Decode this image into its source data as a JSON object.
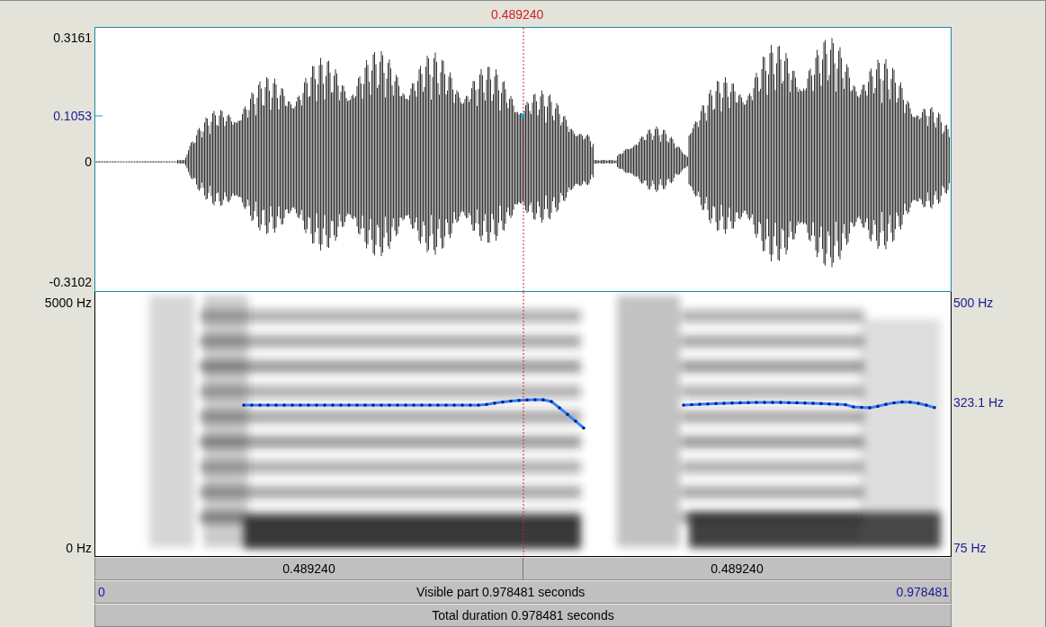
{
  "cursor": {
    "time": "0.489240"
  },
  "waveform": {
    "y_max": "0.3161",
    "cursor_value": "0.1053",
    "y_zero": "0",
    "y_min": "-0.3102"
  },
  "spectrogram": {
    "freq_max": "5000 Hz",
    "freq_min": "0 Hz",
    "pitch_max": "500 Hz",
    "pitch_cursor": "323.1 Hz",
    "pitch_min": "75 Hz"
  },
  "selection_bar": {
    "segments": [
      "0.489240",
      "0.489240"
    ]
  },
  "visible_bar": {
    "start": "0",
    "label": "Visible part 0.978481 seconds",
    "end": "0.978481"
  },
  "total_bar": {
    "label": "Total duration 0.978481 seconds"
  }
}
